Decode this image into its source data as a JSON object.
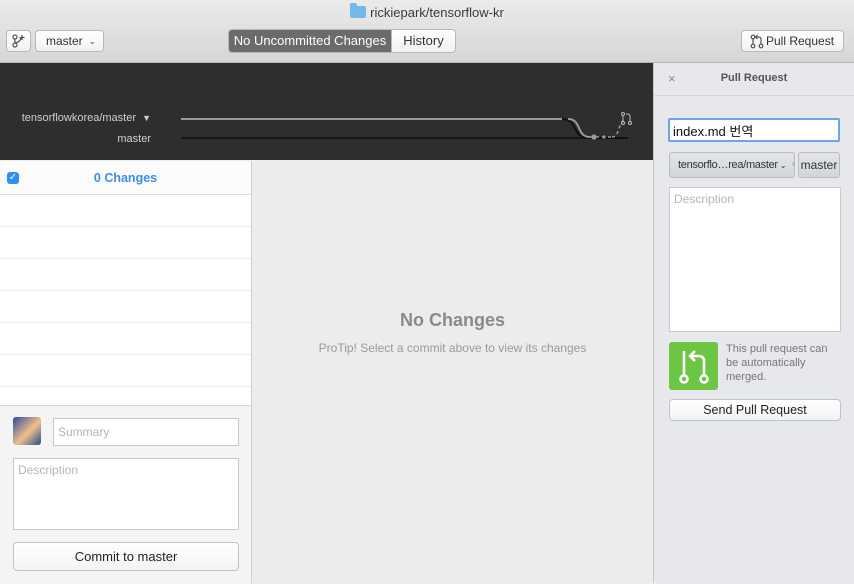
{
  "window": {
    "title": "rickiepark/tensorflow-kr"
  },
  "toolbar": {
    "branch_select": "master",
    "tabs": [
      {
        "label": "No Uncommitted Changes",
        "active": true
      },
      {
        "label": "History",
        "active": false
      }
    ],
    "pull_request_button": "Pull Request"
  },
  "graph": {
    "upstream_branch": "tensorflowkorea/master",
    "local_branch": "master"
  },
  "changes": {
    "header": "0 Changes",
    "all_selected": true
  },
  "commit": {
    "summary_placeholder": "Summary",
    "description_placeholder": "Description",
    "button": "Commit to master"
  },
  "main": {
    "heading": "No Changes",
    "tip": "ProTip! Select a commit above to view its changes"
  },
  "pull_request_panel": {
    "title": "Pull Request",
    "close": "×",
    "title_value": "index.md 번역",
    "base_branch": "tensorflo…rea/master",
    "compare_branch": "master",
    "description_placeholder": "Description",
    "merge_status": "This pull request can be automatically merged.",
    "send_button": "Send Pull Request"
  },
  "colors": {
    "accent_blue": "#3d8ee6",
    "merge_green": "#6cc644",
    "graph_background": "#2e2e2e",
    "active_tab": "#6b6b6b"
  }
}
